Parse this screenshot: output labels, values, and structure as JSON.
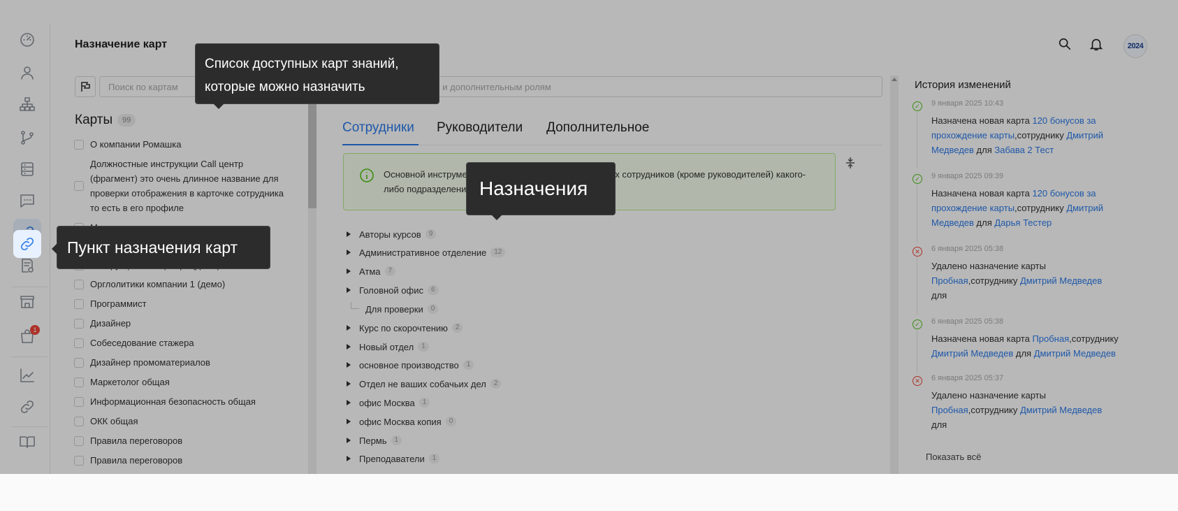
{
  "header": {
    "title": "Назначение карт",
    "avatar_text": "2024"
  },
  "rail": {
    "badge_count": "1",
    "icons": [
      "dashboard-icon",
      "user-icon",
      "org-structure-icon",
      "branch-icon",
      "server-icon",
      "chat-icon",
      "link-icon",
      "document-check-icon",
      "store-icon",
      "shopping-bag-icon",
      "chart-icon",
      "link-icon",
      "book-icon"
    ]
  },
  "cards_panel": {
    "search_placeholder": "Поиск по картам",
    "title": "Карты",
    "count": "99",
    "items": [
      "О компании Ромашка",
      "Должностные инструкции Call центр (фрагмент) это очень длинное название для проверки отображения в карточке сотрудника то есть в его профиле",
      "Менеджер по продажам",
      "Инструкции Call-центра (демо)",
      "Орглолитики компании 1 (демо)",
      "Программист",
      "Дизайнер",
      "Собеседование стажера",
      "Дизайнер промоматериалов",
      "Маркетолог общая",
      "Информационная безопасность общая",
      "ОКК общая",
      "Правила переговоров",
      "Правила переговоров"
    ]
  },
  "main": {
    "search_placeholder": "Поиск по подразделениям и дополнительным ролям",
    "tabs": [
      "Сотрудники",
      "Руководители",
      "Дополнительное"
    ],
    "info_text": "Основной инструмент назначения карт знаний для всех сотрудников (кроме руководителей) какого-либо подразделения",
    "tree": [
      {
        "label": "Авторы курсов",
        "count": "9"
      },
      {
        "label": "Административное отделение",
        "count": "12"
      },
      {
        "label": "Атма",
        "count": "7"
      },
      {
        "label": "Головной офис",
        "count": "6"
      },
      {
        "label": "Для проверки",
        "count": "0"
      },
      {
        "label": "Курс по скорочтению",
        "count": "2"
      },
      {
        "label": "Новый отдел",
        "count": "1"
      },
      {
        "label": "основное производство",
        "count": "1"
      },
      {
        "label": "Отдел не ваших собачьих дел",
        "count": "2"
      },
      {
        "label": "офис Москва",
        "count": "1"
      },
      {
        "label": "офис Москва копия",
        "count": "0"
      },
      {
        "label": "Пермь",
        "count": "1"
      },
      {
        "label": "Преподаватели",
        "count": "1"
      }
    ]
  },
  "history": {
    "title": "История изменений",
    "show_all": "Показать всё",
    "items": [
      {
        "status": "success",
        "date": "9 января 2025 10:43",
        "action": "Назначена новая карта ",
        "card": "120 бонусов за прохождение карты",
        "to": ",сотруднику ",
        "employee": "Дмитрий Медведев",
        "for": " для ",
        "target": "Забава 2 Тест"
      },
      {
        "status": "success",
        "date": "9 января 2025 09:39",
        "action": "Назначена новая карта ",
        "card": "120 бонусов за прохождение карты",
        "to": ",сотруднику ",
        "employee": "Дмитрий Медведев",
        "for": " для ",
        "target": "Дарья Тестер"
      },
      {
        "status": "error",
        "date": "6 января 2025 05:38",
        "action": "Удалено назначение карты ",
        "card": "Пробная",
        "to": ",сотруднику ",
        "employee": "Дмитрий Медведев",
        "for": " для",
        "target": ""
      },
      {
        "status": "success",
        "date": "6 января 2025 05:38",
        "action": "Назначена новая карта ",
        "card": "Пробная",
        "to": ",сотруднику ",
        "employee": "Дмитрий Медведев",
        "for": " для ",
        "target": "Дмитрий Медведев"
      },
      {
        "status": "error",
        "date": "6 января 2025 05:37",
        "action": "Удалено назначение карты ",
        "card": "Пробная",
        "to": ",сотруднику ",
        "employee": "Дмитрий Медведев",
        "for": " для",
        "target": ""
      }
    ]
  },
  "tooltips": {
    "cards": "Список доступных карт знаний, которые можно назначить",
    "assignments": "Назначения",
    "rail_item": "Пункт назначения карт"
  },
  "colors": {
    "accent": "#2b7bea",
    "success": "#52c41a",
    "error": "#f04438",
    "info_bg": "#f6ffed"
  }
}
